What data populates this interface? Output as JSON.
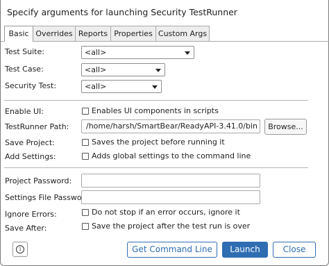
{
  "window": {
    "title": "Specify arguments for launching Security TestRunner"
  },
  "tabs": [
    {
      "label": "Basic",
      "active": true
    },
    {
      "label": "Overrides"
    },
    {
      "label": "Reports"
    },
    {
      "label": "Properties"
    },
    {
      "label": "Custom Args"
    }
  ],
  "form": {
    "test_suite": {
      "label": "Test Suite:",
      "value": "<all>"
    },
    "test_case": {
      "label": "Test Case:",
      "value": "<all>"
    },
    "security_test": {
      "label": "Security Test:",
      "value": "<all>"
    },
    "enable_ui": {
      "label": "Enable UI:",
      "checkbox_label": "Enables UI components in scripts",
      "checked": false
    },
    "testrunner_path": {
      "label": "TestRunner Path:",
      "value": "/home/harsh/SmartBear/ReadyAPI-3.41.0/bin",
      "browse_label": "Browse..."
    },
    "save_project": {
      "label": "Save Project:",
      "checkbox_label": "Saves the project before running it",
      "checked": false
    },
    "add_settings": {
      "label": "Add Settings:",
      "checkbox_label": "Adds global settings to the command line",
      "checked": false
    },
    "project_password": {
      "label": "Project Password:",
      "value": ""
    },
    "settings_file_password": {
      "label": "Settings File Password:",
      "value": ""
    },
    "ignore_errors": {
      "label": "Ignore Errors:",
      "checkbox_label": "Do not stop if an error occurs, ignore it",
      "checked": false
    },
    "save_after": {
      "label": "Save After:",
      "checkbox_label": "Save the project after the test run is over",
      "checked": false
    }
  },
  "footer": {
    "info_icon": "info-icon",
    "get_command_line_label": "Get Command Line",
    "launch_label": "Launch",
    "close_label": "Close"
  },
  "colors": {
    "accent": "#2f6db3"
  }
}
